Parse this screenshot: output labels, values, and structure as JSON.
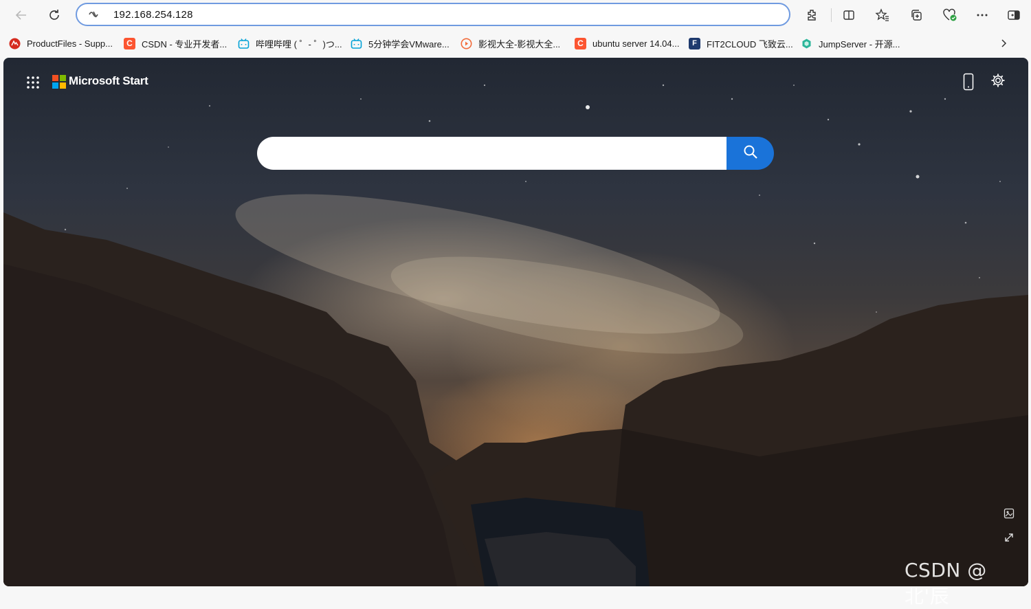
{
  "browser": {
    "address_url": "192.168.254.128"
  },
  "bookmarks": [
    {
      "label": "ProductFiles - Supp...",
      "icon": "vmware-red-icon"
    },
    {
      "label": "CSDN - 专业开发者...",
      "icon": "csdn-c-icon"
    },
    {
      "label": "哔哩哔哩 ( ゜- ゜)つ...",
      "icon": "bilibili-tv-icon"
    },
    {
      "label": "5分钟学会VMware...",
      "icon": "bilibili-tv-icon"
    },
    {
      "label": "影视大全-影视大全...",
      "icon": "play-circle-icon"
    },
    {
      "label": "ubuntu server 14.04...",
      "icon": "csdn-c-icon"
    },
    {
      "label": "FIT2CLOUD 飞致云...",
      "icon": "fit2cloud-icon"
    },
    {
      "label": "JumpServer - 开源...",
      "icon": "jumpserver-icon"
    }
  ],
  "page": {
    "brand_title": "Microsoft Start",
    "search_placeholder": ""
  },
  "watermark": "CSDN @北'辰",
  "colors": {
    "search_button": "#1a73d9",
    "csdn_red": "#fc5531",
    "bilibili_blue": "#00a1d6",
    "address_border": "#6f9ae0"
  }
}
